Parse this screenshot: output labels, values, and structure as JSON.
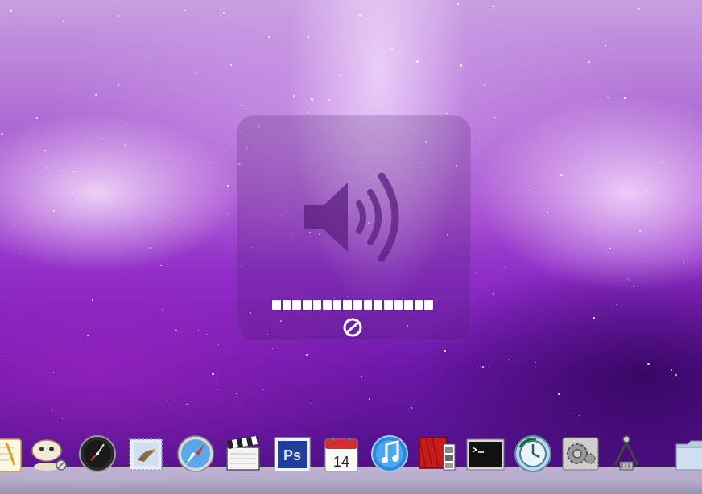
{
  "hud": {
    "volume_level": 1.0,
    "segments_total": 16,
    "segments_filled": 16,
    "muted_indicator": "mute-icon"
  },
  "dock": {
    "items": [
      {
        "icon": "textedit-icon"
      },
      {
        "icon": "photo-tool-icon"
      },
      {
        "icon": "dashboard-icon"
      },
      {
        "icon": "mail-icon"
      },
      {
        "icon": "safari-icon"
      },
      {
        "icon": "imovie-clapper-icon"
      },
      {
        "icon": "photoshop-icon",
        "label": "Ps"
      },
      {
        "icon": "ical-icon",
        "label": "14"
      },
      {
        "icon": "itunes-icon"
      },
      {
        "icon": "photo-booth-icon"
      },
      {
        "icon": "terminal-icon"
      },
      {
        "icon": "time-machine-icon"
      },
      {
        "icon": "system-preferences-icon"
      },
      {
        "icon": "directory-utility-icon"
      },
      {
        "icon": "folder-icon"
      }
    ]
  },
  "colors": {
    "wallpaper_top": "#c89ee0",
    "wallpaper_bottom": "#4a0f80",
    "hud_glyph": "#5a1f80",
    "photoshop_blue": "#1f3f9a",
    "itunes_blue": "#2a8ad8"
  }
}
